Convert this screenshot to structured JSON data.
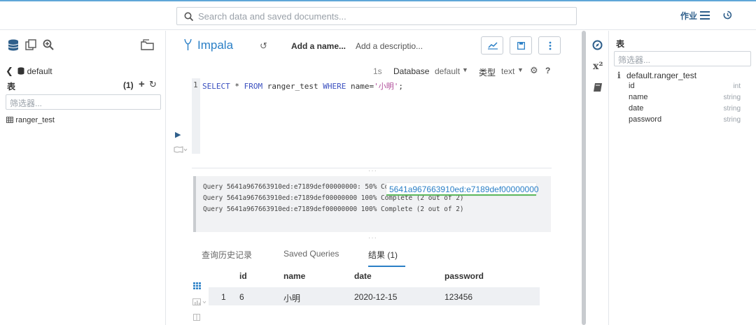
{
  "topbar": {
    "search_placeholder": "Search data and saved documents...",
    "jobs_label": "作业"
  },
  "left": {
    "database": "default",
    "tables_label": "表",
    "tables_count": "(1)",
    "filter_placeholder": "筛选器...",
    "tables": [
      "ranger_test"
    ]
  },
  "editor": {
    "engine": "Impala",
    "name_placeholder": "Add a name...",
    "description_placeholder": "Add a descriptio...",
    "exec_time": "1s",
    "database_label": "Database",
    "database_value": "default",
    "type_label": "类型",
    "type_value": "text",
    "line_number": "1",
    "sql": {
      "kw1": "SELECT",
      "rest1": " * ",
      "kw2": "FROM",
      "rest2": " ranger_test ",
      "kw3": "WHERE",
      "rest3": " name=",
      "str": "'小明'",
      "end": ";"
    }
  },
  "log": {
    "lines": [
      "Query 5641a967663910ed:e7189def00000000: 50% Complete (1 out of 2)",
      "Query 5641a967663910ed:e7189def00000000 100% Complete (2 out of 2)",
      "Query 5641a967663910ed:e7189def00000000 100% Complete (2 out of 2)"
    ],
    "tooltip": "5641a967663910ed:e7189def00000000"
  },
  "tabs": {
    "history": "查询历史记录",
    "saved": "Saved Queries",
    "results": "结果 (1)"
  },
  "results": {
    "headers": [
      "id",
      "name",
      "date",
      "password"
    ],
    "rows": [
      {
        "index": "1",
        "id": "6",
        "name": "小明",
        "date": "2020-12-15",
        "password": "123456"
      }
    ]
  },
  "right": {
    "title": "表",
    "filter_placeholder": "筛选器...",
    "table_name": "default.ranger_test",
    "columns": [
      {
        "name": "id",
        "type": "int"
      },
      {
        "name": "name",
        "type": "string"
      },
      {
        "name": "date",
        "type": "string"
      },
      {
        "name": "password",
        "type": "string"
      }
    ]
  },
  "colors": {
    "accent": "#2a7fc6",
    "keyword": "#3a4fbf",
    "string": "#b14d9a",
    "success": "#5cb85c"
  }
}
